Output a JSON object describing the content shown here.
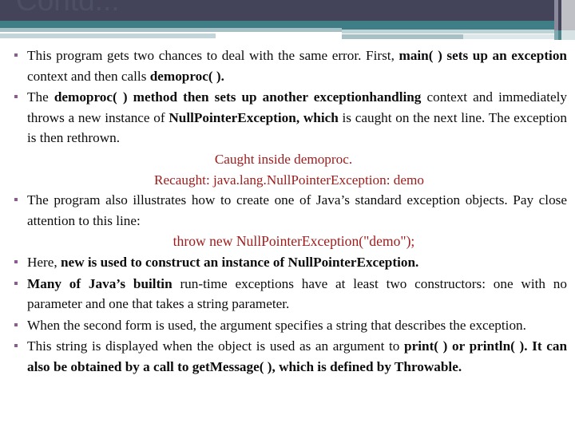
{
  "slide": {
    "title": "Contd...",
    "theme": {
      "dark_band": "#434459",
      "teal_band": "#3f7e87",
      "pale_band": "#a6c0c6",
      "bullet_color": "#8a5d8f",
      "code_color": "#9e1b1b",
      "body_text_color": "#0d0d0d",
      "background": "#ffffff"
    }
  },
  "content": {
    "bullets": [
      {
        "id": "bullet-1",
        "runs": [
          {
            "text": "This program gets two chances to deal with the same error. First, ",
            "bold": false
          },
          {
            "text": "main( ) sets up an exception",
            "bold": true
          },
          {
            "text": " context and then calls ",
            "bold": false
          },
          {
            "text": "demoproc( ).",
            "bold": true
          }
        ]
      },
      {
        "id": "bullet-2",
        "runs": [
          {
            "text": "The ",
            "bold": false
          },
          {
            "text": "demoproc( ) method then sets up another exceptionhandling",
            "bold": true
          },
          {
            "text": " context and immediately throws a new instance of ",
            "bold": false
          },
          {
            "text": "NullPointerException, which",
            "bold": true
          },
          {
            "text": " is caught on the next line. The exception is then rethrown.",
            "bold": false
          }
        ]
      },
      {
        "id": "bullet-3",
        "runs": [
          {
            "text": "The program also illustrates how to create one of Java’s standard exception objects. Pay close attention to this line:",
            "bold": false
          }
        ]
      },
      {
        "id": "bullet-4",
        "runs": [
          {
            "text": "Here, ",
            "bold": false
          },
          {
            "text": "new is used to construct an instance of NullPointerException.",
            "bold": true
          }
        ]
      },
      {
        "id": "bullet-5",
        "runs": [
          {
            "text": "Many of Java’s builtin",
            "bold": true
          },
          {
            "text": " run-time exceptions have at least two constructors: one with no parameter and one that takes a string parameter.",
            "bold": false
          }
        ]
      },
      {
        "id": "bullet-6",
        "runs": [
          {
            "text": "When the second form is used, the argument specifies a string that describes the exception.",
            "bold": false
          }
        ]
      },
      {
        "id": "bullet-7",
        "runs": [
          {
            "text": "This string is displayed when the object is used as an argument to ",
            "bold": false
          },
          {
            "text": "print( ) or println( ). It can also be obtained by a call to getMessage( ), which is defined by Throwable.",
            "bold": true
          }
        ]
      }
    ],
    "output_lines": [
      {
        "id": "output-line-1",
        "text": "Caught inside demoproc."
      },
      {
        "id": "output-line-2",
        "text": "Recaught: java.lang.NullPointerException: demo"
      }
    ],
    "code_line": {
      "id": "code-statement",
      "text": "throw new NullPointerException(\"demo\");"
    }
  }
}
